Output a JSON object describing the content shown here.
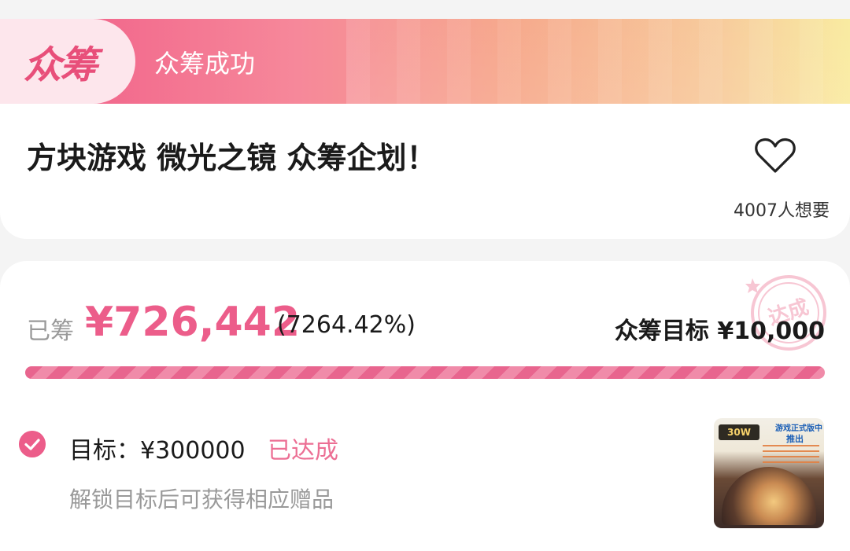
{
  "banner": {
    "badge": "众筹",
    "status": "众筹成功"
  },
  "project": {
    "title": "方块游戏 微光之镜 众筹企划！",
    "want_count": "4007人想要"
  },
  "funding": {
    "raised_label": "已筹",
    "raised_amount": "¥726,442",
    "raised_percent": "(7264.42%)",
    "goal_text": "众筹目标 ¥10,000",
    "progress_fraction": 1.0,
    "stamp_text": "达成"
  },
  "stretch_goal": {
    "label": "目标：¥300000",
    "status": "已达成",
    "hint": "解锁目标后可获得相应赠品",
    "thumb": {
      "pill": "30W",
      "line1": "游戏正式版中",
      "line2": "推出"
    }
  },
  "colors": {
    "accent": "#ec5d8a",
    "banner_start": "#f05a86",
    "banner_end": "#f9ea9c"
  },
  "icons": {
    "favorite": "heart-outline-icon",
    "achieved": "check-circle-icon"
  }
}
